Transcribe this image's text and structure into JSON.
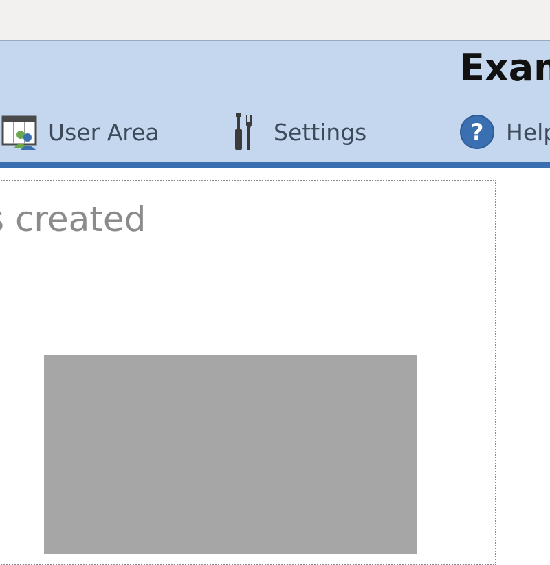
{
  "app": {
    "title": "Exam"
  },
  "ribbon": {
    "items": [
      {
        "label": "User Area",
        "icon": "user-area-icon"
      },
      {
        "label": "Settings",
        "icon": "tools-icon"
      },
      {
        "label": "Help",
        "icon": "help-icon"
      }
    ]
  },
  "content": {
    "heading": "s created"
  },
  "colors": {
    "ribbon_bg": "#c5d7ee",
    "ribbon_accent": "#3a70b2",
    "help_icon": "#3a70b2"
  }
}
